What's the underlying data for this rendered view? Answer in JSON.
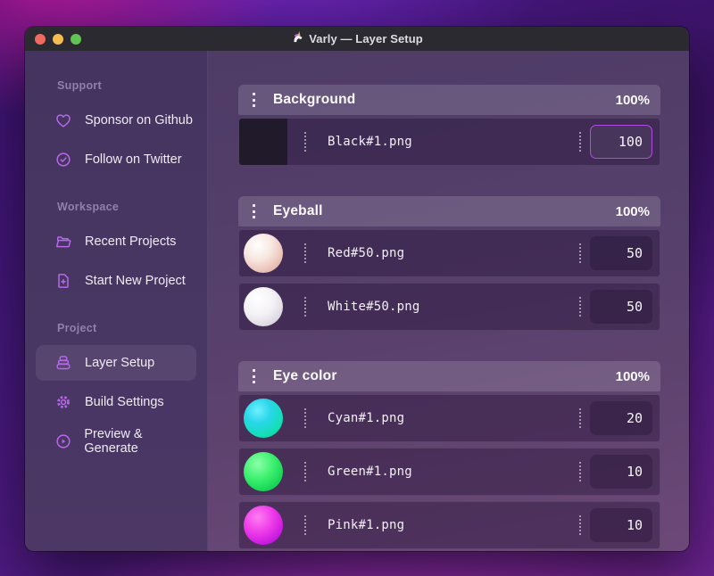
{
  "window": {
    "title": "Varly — Layer Setup",
    "app_icon": "unicorn-icon",
    "traffic_lights": [
      {
        "name": "close-button",
        "color": "#ee6a5f"
      },
      {
        "name": "minimize-button",
        "color": "#f5bd4f"
      },
      {
        "name": "zoom-button",
        "color": "#61c354"
      }
    ]
  },
  "sidebar": {
    "sections": [
      {
        "label": "Support",
        "items": [
          {
            "label": "Sponsor on Github",
            "icon": "heart-icon"
          },
          {
            "label": "Follow on Twitter",
            "icon": "verified-badge-icon"
          }
        ]
      },
      {
        "label": "Workspace",
        "items": [
          {
            "label": "Recent Projects",
            "icon": "folder-icon"
          },
          {
            "label": "Start New Project",
            "icon": "new-document-icon"
          }
        ]
      },
      {
        "label": "Project",
        "items": [
          {
            "label": "Layer Setup",
            "icon": "layers-icon",
            "selected": true
          },
          {
            "label": "Build Settings",
            "icon": "gear-icon"
          },
          {
            "label": "Preview & Generate",
            "icon": "play-circle-icon"
          }
        ]
      }
    ]
  },
  "main": {
    "groups": [
      {
        "name": "Background",
        "weight": "100%",
        "layers": [
          {
            "file": "Black#1.png",
            "value": "100",
            "thumb": "black-square",
            "focused": true
          }
        ]
      },
      {
        "name": "Eyeball",
        "weight": "100%",
        "layers": [
          {
            "file": "Red#50.png",
            "value": "50",
            "thumb": "red-sphere"
          },
          {
            "file": "White#50.png",
            "value": "50",
            "thumb": "white-sphere"
          }
        ]
      },
      {
        "name": "Eye color",
        "weight": "100%",
        "layers": [
          {
            "file": "Cyan#1.png",
            "value": "20",
            "thumb": "cyan-sphere"
          },
          {
            "file": "Green#1.png",
            "value": "10",
            "thumb": "green-sphere"
          },
          {
            "file": "Pink#1.png",
            "value": "10",
            "thumb": "pink-sphere"
          }
        ]
      }
    ]
  },
  "colors": {
    "accent": "#b14ae0",
    "sidebar_icon": "#b668ea",
    "titlebar": "#2b2a31",
    "sidebar_bg": "#483663",
    "main_bg": "#553f6b",
    "row_border": "rgba(255,255,255,0.10)"
  }
}
